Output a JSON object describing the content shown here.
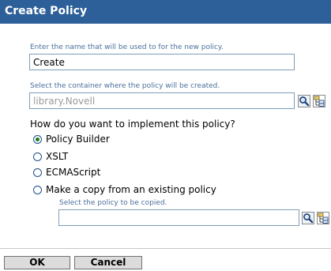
{
  "header": {
    "title": "Create Policy"
  },
  "name_section": {
    "caption": "Enter the name that will be used to for the new policy.",
    "value": "Create"
  },
  "container_section": {
    "caption": "Select the container where the policy will be created.",
    "value": "library.Novell"
  },
  "implement": {
    "question": "How do you want to implement this policy?",
    "options": [
      {
        "label": "Policy Builder",
        "checked": true
      },
      {
        "label": "XSLT",
        "checked": false
      },
      {
        "label": "ECMAScript",
        "checked": false
      },
      {
        "label": "Make a copy from an existing policy",
        "checked": false
      }
    ]
  },
  "copy_section": {
    "caption": "Select the policy to be copied.",
    "value": ""
  },
  "footer": {
    "ok_label": "OK",
    "cancel_label": "Cancel"
  },
  "colors": {
    "title_bar": "#2d5f98",
    "caption_text": "#4a6f9b",
    "radio_selected": "#1a7a1a"
  },
  "icons": [
    "search-icon",
    "browse-tree-icon"
  ]
}
